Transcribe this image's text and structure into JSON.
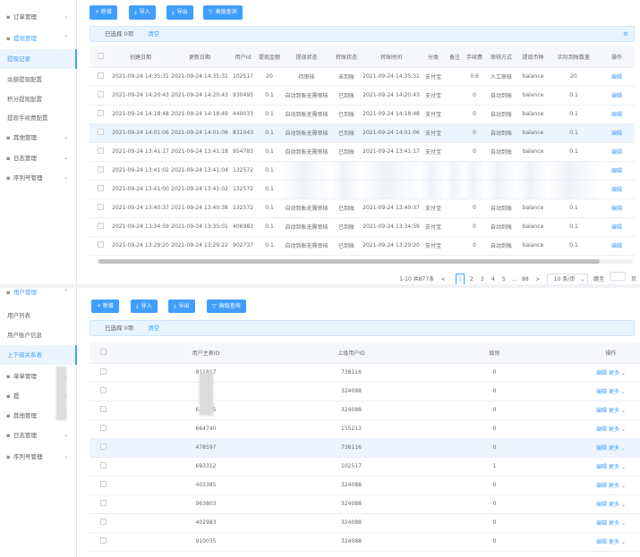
{
  "panel1": {
    "sidebar": [
      {
        "label": "订单管理",
        "icon": "menu",
        "chevron": "⌄",
        "kind": "top"
      },
      {
        "label": "提现管理",
        "icon": "menu",
        "chevron": "⌃",
        "kind": "open"
      },
      {
        "label": "提现记录",
        "kind": "active"
      },
      {
        "label": "余额提现配置",
        "kind": "sub"
      },
      {
        "label": "积分提现配置",
        "kind": "sub"
      },
      {
        "label": "提现手续费配置",
        "kind": "sub"
      },
      {
        "label": "其他管理",
        "icon": "menu",
        "chevron": "⌄",
        "kind": "top"
      },
      {
        "label": "日志管理",
        "icon": "menu",
        "chevron": "⌄",
        "kind": "top"
      },
      {
        "label": "序列号管理",
        "icon": "menu",
        "chevron": "⌄",
        "kind": "top"
      }
    ],
    "toolbar": {
      "add": "+ 新增",
      "import": "导入",
      "export": "导出",
      "advanced": "高级查询"
    },
    "selection": {
      "text": "已选择 0项",
      "clear": "清空"
    },
    "columns": [
      "",
      "创建日期",
      "更新日期",
      "用户id",
      "提现金额",
      "提现状态",
      "转账状态",
      "转账时间",
      "分类",
      "备注",
      "手续费",
      "审核方式",
      "提现币种",
      "实际到账数量",
      "操作"
    ],
    "rows": [
      [
        "2021-09-24 14:35:31",
        "2021-09-24 14:35:31",
        "102517",
        "20",
        "待审核",
        "未到账",
        "2021-09-24 14:35:31",
        "支付宝",
        "",
        "0.6",
        "人工审核",
        "balance",
        "20",
        "编辑"
      ],
      [
        "2021-09-24 14:20:43",
        "2021-09-24 14:20:43",
        "930495",
        "0.1",
        "自动到账无需审核",
        "已到账",
        "2021-09-24 14:20:43",
        "支付宝",
        "",
        "0",
        "自动到账",
        "balance",
        "0.1",
        "编辑"
      ],
      [
        "2021-09-24 14:18:48",
        "2021-09-24 14:18:49",
        "449033",
        "0.1",
        "自动到账无需审核",
        "已到账",
        "2021-09-24 14:18:48",
        "支付宝",
        "",
        "0",
        "自动到账",
        "balance",
        "0.1",
        "编辑"
      ],
      [
        "2021-09-24 14:01:06",
        "2021-09-24 14:01:08",
        "831043",
        "0.1",
        "自动到账无需审核",
        "已到账",
        "2021-09-24 14:01:06",
        "支付宝",
        "",
        "0",
        "自动到账",
        "balance",
        "0.1",
        "编辑"
      ],
      [
        "2021-09-24 13:41:17",
        "2021-09-24 13:41:18",
        "954783",
        "0.1",
        "自动到账无需审核",
        "已到账",
        "2021-09-24 13:41:17",
        "支付宝",
        "",
        "0",
        "自动到账",
        "balance",
        "0.1",
        "编辑"
      ],
      [
        "2021-09-24 13:41:02",
        "2021-09-24 13:41:04",
        "132572",
        "0.1",
        "",
        "",
        "",
        "",
        "",
        "",
        "",
        "",
        "",
        "编辑"
      ],
      [
        "2021-09-24 13:41:00",
        "2021-09-24 13:41:02",
        "132572",
        "0.1",
        "",
        "",
        "",
        "",
        "",
        "",
        "",
        "",
        "",
        "编辑"
      ],
      [
        "2021-09-24 13:40:37",
        "2021-09-24 13:40:38",
        "132572",
        "0.1",
        "自动到账无需审核",
        "已到账",
        "2021-09-24 13:40:37",
        "支付宝",
        "",
        "0",
        "自动到账",
        "balance",
        "0.1",
        "编辑"
      ],
      [
        "2021-09-24 13:34:59",
        "2021-09-24 13:35:01",
        "406983",
        "0.1",
        "自动到账无需审核",
        "已到账",
        "2021-09-24 13:34:59",
        "支付宝",
        "",
        "0",
        "自动到账",
        "balance",
        "0.1",
        "编辑"
      ],
      [
        "2021-09-24 13:29:20",
        "2021-09-24 13:29:22",
        "902737",
        "0.1",
        "自动到账无需审核",
        "已到账",
        "2021-09-24 13:29:20",
        "支付宝",
        "",
        "0",
        "自动到账",
        "balance",
        "0.1",
        "编辑"
      ]
    ],
    "pager": {
      "summary": "1-10 共877条",
      "prev": "<",
      "pages": [
        "1",
        "2",
        "3",
        "4",
        "5",
        "...",
        "88"
      ],
      "next": ">",
      "page_size": "10 条/页",
      "goto": "跳至",
      "page_unit": "页"
    }
  },
  "panel2": {
    "sidebar": [
      {
        "label": "用户管理",
        "icon": "menu",
        "chevron": "⌃",
        "kind": "open"
      },
      {
        "label": "用户列表",
        "kind": "sub"
      },
      {
        "label": "用户账户信息",
        "kind": "sub"
      },
      {
        "label": "上下级关系表",
        "kind": "active"
      },
      {
        "label": "单单管理",
        "icon": "menu",
        "chevron": "⌄",
        "kind": "top"
      },
      {
        "label": "提",
        "icon": "menu",
        "chevron": "⌄",
        "kind": "top"
      },
      {
        "label": "其他管理",
        "icon": "menu",
        "chevron": "⌄",
        "kind": "top"
      },
      {
        "label": "日志管理",
        "icon": "menu",
        "chevron": "⌄",
        "kind": "top"
      },
      {
        "label": "序列号管理",
        "icon": "menu",
        "chevron": "⌄",
        "kind": "top"
      }
    ],
    "toolbar": {
      "add": "+ 新增",
      "import": "导入",
      "export": "导出",
      "advanced": "高级查询"
    },
    "selection": {
      "text": "已选择 0项",
      "clear": "清空"
    },
    "columns": [
      "",
      "用户主表ID",
      "上级用户ID",
      "级别",
      "操作"
    ],
    "rows": [
      [
        "911817",
        "738116",
        "0",
        "编辑",
        "更多"
      ],
      [
        "",
        "324088",
        "0",
        "编辑",
        "更多"
      ],
      [
        "620785",
        "324088",
        "0",
        "编辑",
        "更多"
      ],
      [
        "664740",
        "155213",
        "0",
        "编辑",
        "更多"
      ],
      [
        "478597",
        "738116",
        "0",
        "编辑",
        "更多"
      ],
      [
        "693312",
        "102517",
        "1",
        "编辑",
        "更多"
      ],
      [
        "403385",
        "324088",
        "0",
        "编辑",
        "更多"
      ],
      [
        "963803",
        "324088",
        "0",
        "编辑",
        "更多"
      ],
      [
        "402983",
        "324088",
        "0",
        "编辑",
        "更多"
      ],
      [
        "910035",
        "324088",
        "0",
        "编辑",
        "更多"
      ]
    ]
  }
}
